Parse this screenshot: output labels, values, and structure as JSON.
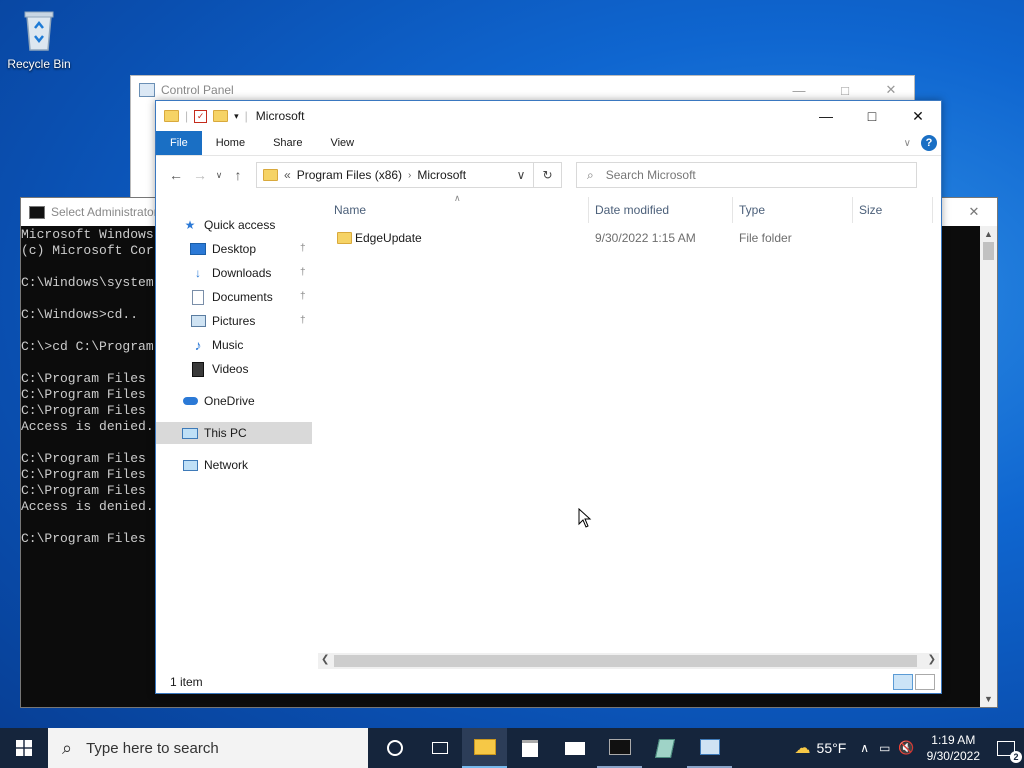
{
  "desktop": {
    "recycle_bin_label": "Recycle Bin"
  },
  "control_panel": {
    "title": "Control Panel"
  },
  "cmd": {
    "title": "Select Administrator",
    "lines": [
      "Microsoft Windows",
      "(c) Microsoft Cor",
      "",
      "C:\\Windows\\system",
      "",
      "C:\\Windows>cd..",
      "",
      "C:\\>cd C:\\Program",
      "",
      "C:\\Program Files",
      "C:\\Program Files",
      "C:\\Program Files",
      "Access is denied.",
      "",
      "C:\\Program Files",
      "C:\\Program Files",
      "C:\\Program Files",
      "Access is denied.",
      "",
      "C:\\Program Files"
    ]
  },
  "explorer": {
    "title": "Microsoft",
    "ribbon_tabs": [
      "File",
      "Home",
      "Share",
      "View"
    ],
    "address": {
      "prefix": "«",
      "crumbs": [
        "Program Files (x86)",
        "Microsoft"
      ]
    },
    "search_placeholder": "Search Microsoft",
    "nav": {
      "quick_access": "Quick access",
      "desktop": "Desktop",
      "downloads": "Downloads",
      "documents": "Documents",
      "pictures": "Pictures",
      "music": "Music",
      "videos": "Videos",
      "onedrive": "OneDrive",
      "this_pc": "This PC",
      "network": "Network"
    },
    "columns": {
      "name": "Name",
      "date": "Date modified",
      "type": "Type",
      "size": "Size"
    },
    "files": [
      {
        "name": "EdgeUpdate",
        "date": "9/30/2022 1:15 AM",
        "type": "File folder",
        "size": ""
      }
    ],
    "status": "1 item"
  },
  "taskbar": {
    "search_placeholder": "Type here to search",
    "weather": "55°F",
    "time": "1:19 AM",
    "date": "9/30/2022",
    "notification_count": "2"
  }
}
